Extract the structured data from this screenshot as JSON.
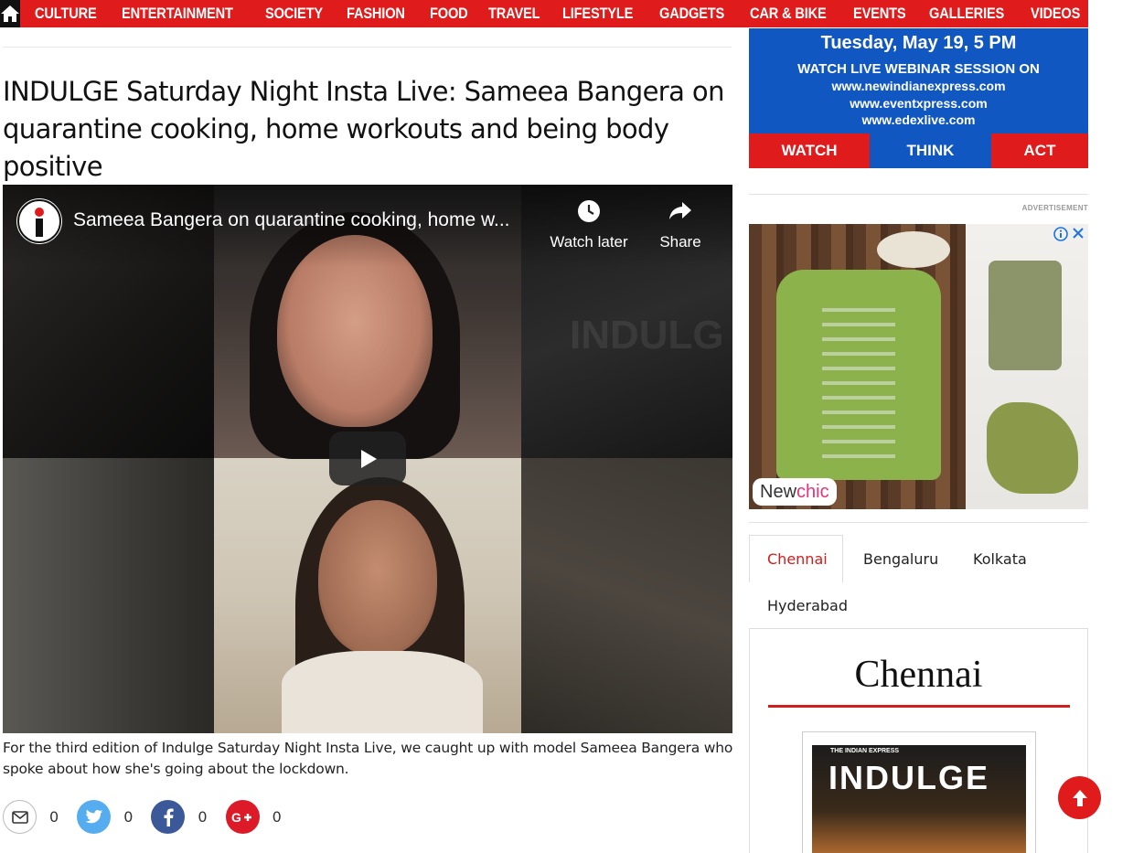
{
  "nav": {
    "home_icon": "home-icon",
    "items": [
      "CULTURE",
      "ENTERTAINMENT",
      "SOCIETY",
      "FASHION",
      "FOOD",
      "TRAVEL",
      "LIFESTYLE",
      "GADGETS",
      "CAR & BIKE",
      "EVENTS",
      "GALLERIES",
      "VIDEOS"
    ]
  },
  "article": {
    "headline": "INDULGE Saturday Night Insta Live: Sameea Bangera on quarantine cooking, home workouts and being body positive",
    "caption": "For the third edition of Indulge Saturday Night Insta Live, we caught up with model Sameea Bangera who spoke about how she's going about the lockdown."
  },
  "video": {
    "title": "Sameea Bangera on quarantine cooking, home w...",
    "watch_later": "Watch later",
    "share": "Share",
    "watermark": "INDULG",
    "channel_icon": "indulge-logo-icon",
    "play_icon": "play-icon"
  },
  "share": {
    "email_count": "0",
    "twitter_count": "0",
    "facebook_count": "0",
    "google_count": "0"
  },
  "webinar": {
    "date": "Tuesday, May 19, 5 PM",
    "headline": "WATCH LIVE WEBINAR SESSION ON",
    "urls": [
      "www.newindianexpress.com",
      "www.eventxpress.com",
      "www.edexlive.com"
    ],
    "buttons": [
      "WATCH",
      "THINK",
      "ACT"
    ],
    "colors": {
      "blue": "#1157c2",
      "red": "#e01b1b"
    }
  },
  "ad": {
    "label": "ADVERTISEMENT",
    "brand_new": "New",
    "brand_chic": "chic"
  },
  "cities": {
    "tabs": [
      "Chennai",
      "Bengaluru",
      "Kolkata",
      "Hyderabad"
    ],
    "active": "Chennai",
    "heading": "Chennai",
    "magazine_publisher": "THE INDIAN EXPRESS",
    "magazine_title": "INDULGE"
  },
  "colors": {
    "accent": "#e01b1b",
    "twitter": "#55acee",
    "facebook": "#3b5998",
    "google": "#dd4b39"
  }
}
